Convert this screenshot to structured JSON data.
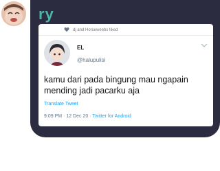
{
  "message": {
    "text": "ry"
  },
  "tweet": {
    "liked_by": "dj and Horseweebs liked",
    "author_name": "EL",
    "author_handle": "@halupulisi",
    "text_line1": "kamu dari pada bingung mau ngapain",
    "text_line2": "mending jadi pacarku aja",
    "translate_label": "Translate Tweet",
    "time": "9:09 PM",
    "separator": "·",
    "date": "12 Dec 20",
    "client": "Twitter for Android"
  },
  "colors": {
    "bubble": "#2b2c3f",
    "accent_text": "#4fb5a8",
    "link": "#1da1f2"
  }
}
